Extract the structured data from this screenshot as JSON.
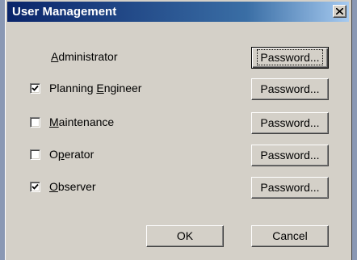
{
  "window": {
    "title": "User Management",
    "close_icon": "close-x-icon"
  },
  "users": [
    {
      "name_pre": "",
      "name_mnemonic": "A",
      "name_post": "dministrator",
      "checkbox": false,
      "checked": false,
      "password_label": "Password..."
    },
    {
      "name_pre": "Planning ",
      "name_mnemonic": "E",
      "name_post": "ngineer",
      "checkbox": true,
      "checked": true,
      "password_label": "Password..."
    },
    {
      "name_pre": "",
      "name_mnemonic": "M",
      "name_post": "aintenance",
      "checkbox": true,
      "checked": false,
      "password_label": "Password..."
    },
    {
      "name_pre": "O",
      "name_mnemonic": "p",
      "name_post": "erator",
      "checkbox": true,
      "checked": false,
      "password_label": "Password..."
    },
    {
      "name_pre": "",
      "name_mnemonic": "O",
      "name_post": "bserver",
      "checkbox": true,
      "checked": true,
      "password_label": "Password..."
    }
  ],
  "buttons": {
    "ok": "OK",
    "cancel": "Cancel"
  },
  "colors": {
    "title_bar_start": "#0a246a",
    "title_bar_end": "#a6caf0",
    "dialog_face": "#d4d0c8",
    "desktop": "#8a98b4"
  }
}
